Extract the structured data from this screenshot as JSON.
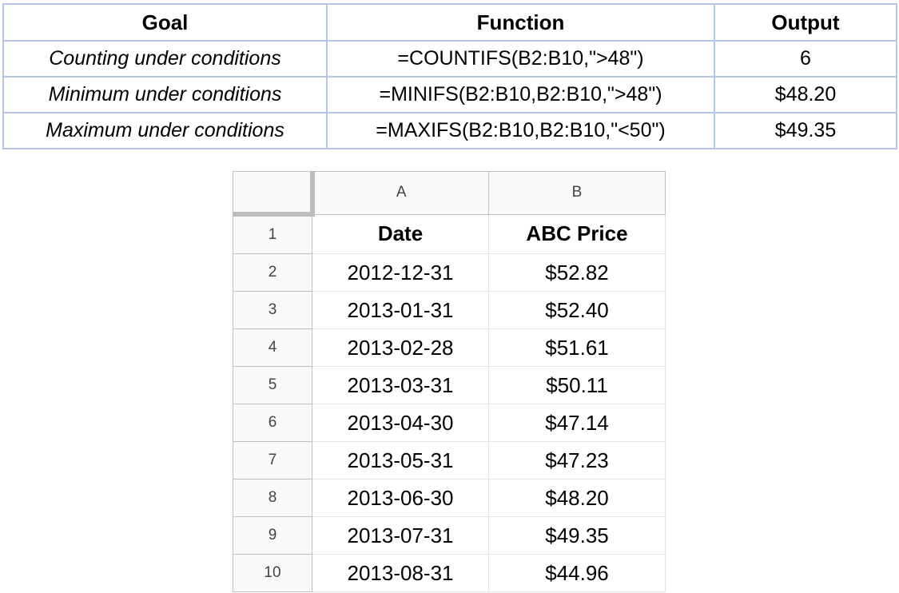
{
  "summary": {
    "headers": {
      "goal": "Goal",
      "function": "Function",
      "output": "Output"
    },
    "rows": [
      {
        "goal": "Counting under conditions",
        "function": "=COUNTIFS(B2:B10,\">48\")",
        "output": "6"
      },
      {
        "goal": "Minimum under conditions",
        "function": "=MINIFS(B2:B10,B2:B10,\">48\")",
        "output": "$48.20"
      },
      {
        "goal": "Maximum under conditions",
        "function": "=MAXIFS(B2:B10,B2:B10,\"<50\")",
        "output": "$49.35"
      }
    ]
  },
  "sheet": {
    "column_headers": [
      "A",
      "B"
    ],
    "rows": [
      {
        "num": "1",
        "a": "Date",
        "b": "ABC Price"
      },
      {
        "num": "2",
        "a": "2012-12-31",
        "b": "$52.82"
      },
      {
        "num": "3",
        "a": "2013-01-31",
        "b": "$52.40"
      },
      {
        "num": "4",
        "a": "2013-02-28",
        "b": "$51.61"
      },
      {
        "num": "5",
        "a": "2013-03-31",
        "b": "$50.11"
      },
      {
        "num": "6",
        "a": "2013-04-30",
        "b": "$47.14"
      },
      {
        "num": "7",
        "a": "2013-05-31",
        "b": "$47.23"
      },
      {
        "num": "8",
        "a": "2013-06-30",
        "b": "$48.20"
      },
      {
        "num": "9",
        "a": "2013-07-31",
        "b": "$49.35"
      },
      {
        "num": "10",
        "a": "2013-08-31",
        "b": "$44.96"
      }
    ]
  },
  "colors": {
    "summary_border": "#b5c7e8",
    "sheet_header_bg": "#f8f9fa",
    "sheet_gridline": "#e2e3e3"
  }
}
